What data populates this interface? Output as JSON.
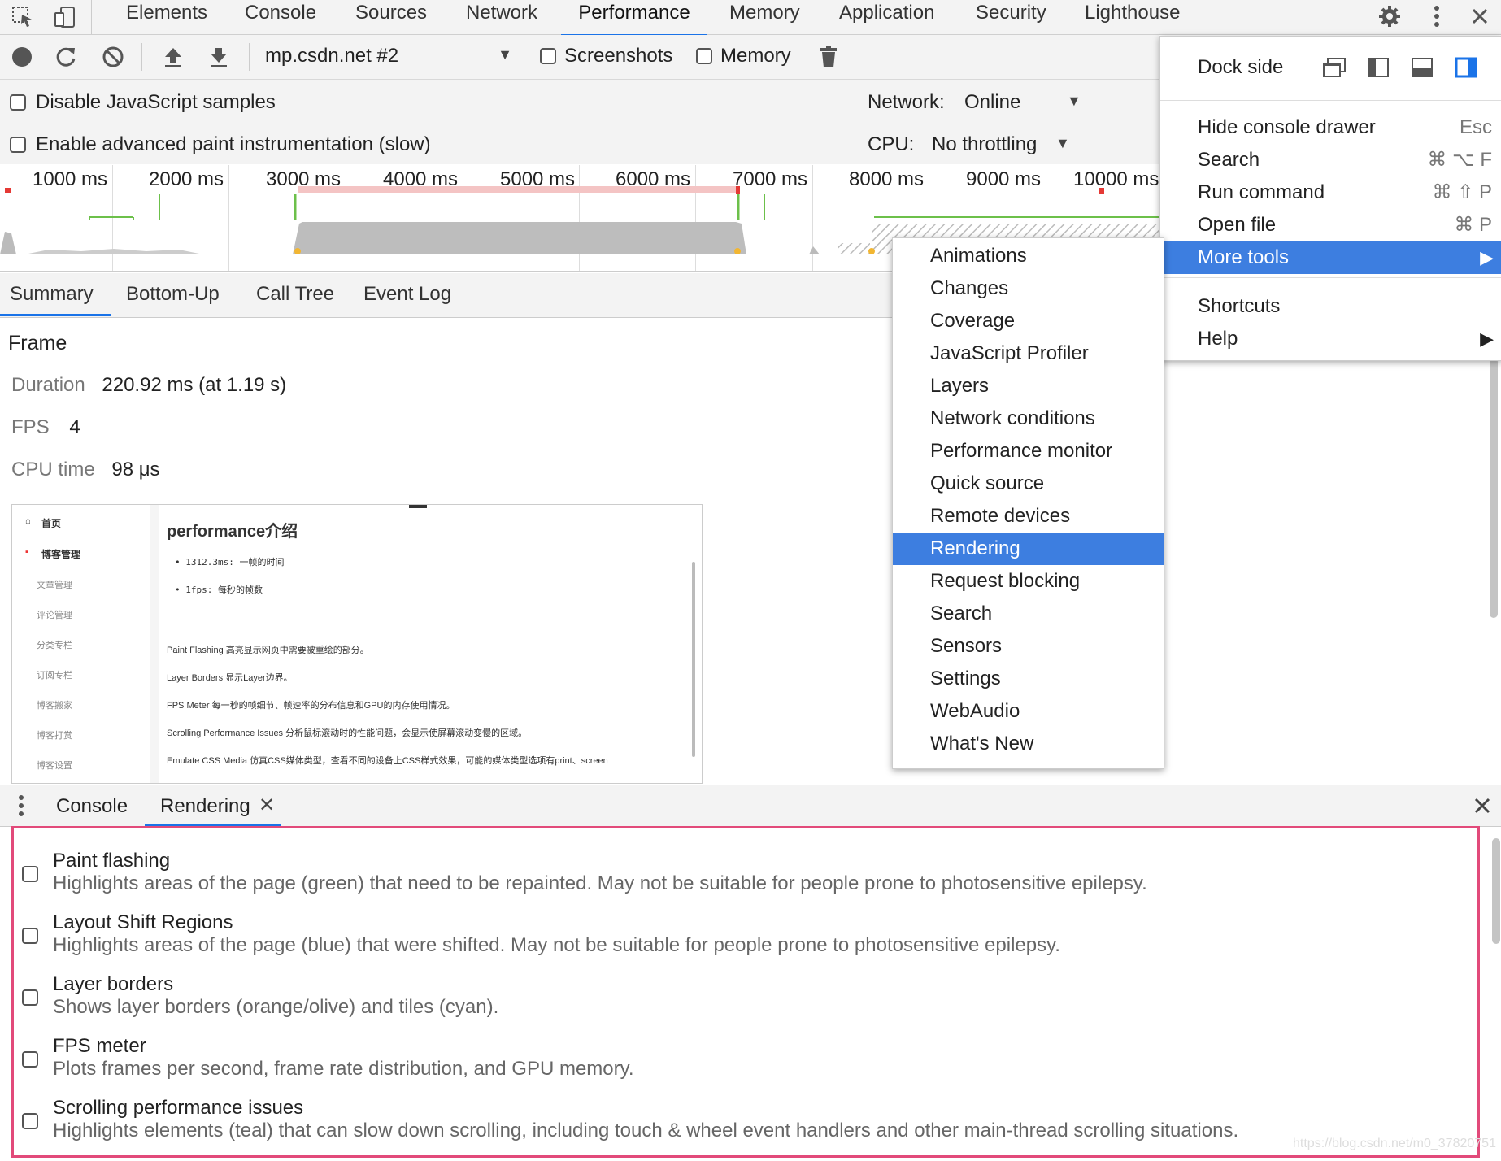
{
  "top_tabs": [
    "Elements",
    "Console",
    "Sources",
    "Network",
    "Performance",
    "Memory",
    "Application",
    "Security",
    "Lighthouse"
  ],
  "toolbar": {
    "target": "mp.csdn.net #2",
    "screenshots_label": "Screenshots",
    "memory_label": "Memory"
  },
  "settings": {
    "disable_js_samples": "Disable JavaScript samples",
    "advanced_paint": "Enable advanced paint instrumentation (slow)",
    "network_label": "Network:",
    "network_value": "Online",
    "cpu_label": "CPU:",
    "cpu_value": "No throttling"
  },
  "overview_ticks": [
    "1000 ms",
    "2000 ms",
    "3000 ms",
    "4000 ms",
    "5000 ms",
    "6000 ms",
    "7000 ms",
    "8000 ms",
    "9000 ms",
    "10000 ms"
  ],
  "detail_tabs": [
    "Summary",
    "Bottom-Up",
    "Call Tree",
    "Event Log"
  ],
  "summary": {
    "heading": "Frame",
    "duration_label": "Duration",
    "duration_value": "220.92 ms (at 1.19 s)",
    "fps_label": "FPS",
    "fps_value": "4",
    "cpu_label": "CPU time",
    "cpu_value": "98 μs"
  },
  "thumbnail": {
    "sidebar": [
      "首页",
      "博客管理",
      "文章管理",
      "评论管理",
      "分类专栏",
      "订阅专栏",
      "博客搬家",
      "博客打赏",
      "博客设置"
    ],
    "title": "performance介绍",
    "bullets": [
      "1312.3ms: 一帧的时间",
      "1fps: 每秒的帧数"
    ],
    "lines": [
      "Paint Flashing 高亮显示网页中需要被重绘的部分。",
      "Layer Borders 显示Layer边界。",
      "FPS Meter 每一秒的帧细节、帧速率的分布信息和GPU的内存使用情况。",
      "Scrolling Performance Issues 分析鼠标滚动时的性能问题，会显示使屏幕滚动变慢的区域。",
      "Emulate CSS Media 仿真CSS媒体类型，查看不同的设备上CSS样式效果，可能的媒体类型选项有print、screen"
    ]
  },
  "main_menu": {
    "dock_side": "Dock side",
    "items": [
      {
        "label": "Hide console drawer",
        "shortcut": "Esc"
      },
      {
        "label": "Search",
        "shortcut": "⌘ ⌥ F"
      },
      {
        "label": "Run command",
        "shortcut": "⌘ ⇧ P"
      },
      {
        "label": "Open file",
        "shortcut": "⌘ P"
      },
      {
        "label": "More tools",
        "shortcut": ""
      },
      {
        "label": "Shortcuts",
        "shortcut": ""
      },
      {
        "label": "Help",
        "shortcut": ""
      }
    ]
  },
  "more_tools": [
    "Animations",
    "Changes",
    "Coverage",
    "JavaScript Profiler",
    "Layers",
    "Network conditions",
    "Performance monitor",
    "Quick source",
    "Remote devices",
    "Rendering",
    "Request blocking",
    "Search",
    "Sensors",
    "Settings",
    "WebAudio",
    "What's New"
  ],
  "drawer": {
    "tabs": [
      "Console",
      "Rendering"
    ]
  },
  "rendering_options": [
    {
      "title": "Paint flashing",
      "desc": "Highlights areas of the page (green) that need to be repainted. May not be suitable for people prone to photosensitive epilepsy."
    },
    {
      "title": "Layout Shift Regions",
      "desc": "Highlights areas of the page (blue) that were shifted. May not be suitable for people prone to photosensitive epilepsy."
    },
    {
      "title": "Layer borders",
      "desc": "Shows layer borders (orange/olive) and tiles (cyan)."
    },
    {
      "title": "FPS meter",
      "desc": "Plots frames per second, frame rate distribution, and GPU memory."
    },
    {
      "title": "Scrolling performance issues",
      "desc": "Highlights elements (teal) that can slow down scrolling, including touch & wheel event handlers and other main-thread scrolling situations."
    }
  ],
  "watermark": "https://blog.csdn.net/m0_37820751",
  "colors": {
    "accent": "#1a73e8",
    "menu_highlight": "#3d7ee0",
    "panel_border": "#e24a7a"
  }
}
